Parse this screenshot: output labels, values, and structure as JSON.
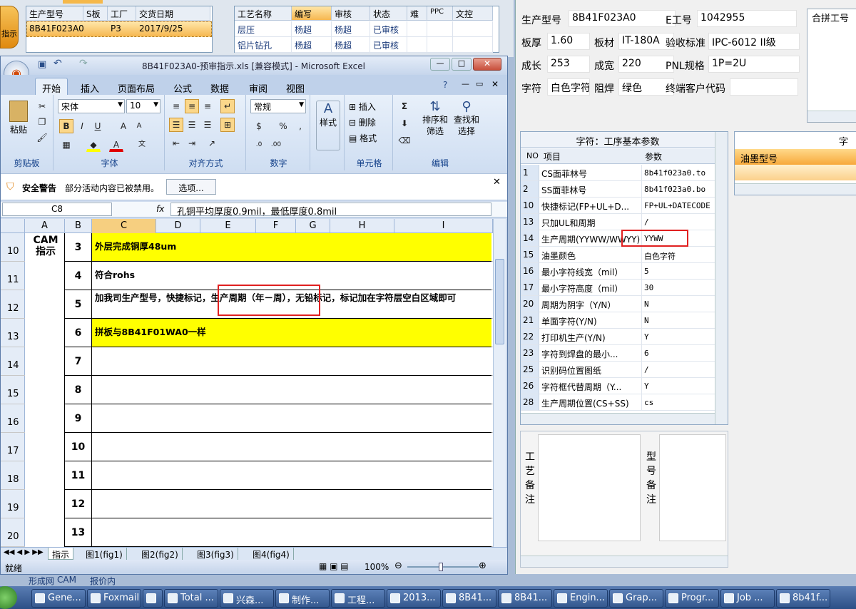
{
  "bg_app": {
    "left_btn": "指示",
    "order_table": {
      "headers": [
        "生产型号",
        "S板",
        "工厂",
        "交货日期"
      ],
      "row": [
        "8B41F023A0",
        "",
        "P3",
        "2017/9/25"
      ]
    },
    "process_table": {
      "headers": [
        "工艺名称",
        "编写",
        "审核",
        "状态",
        "难",
        "PPC",
        "文控"
      ],
      "rows": [
        [
          "层压",
          "杨超",
          "杨超",
          "已审核"
        ],
        [
          "铝片钻孔",
          "杨超",
          "杨超",
          "已审核"
        ]
      ]
    },
    "bottom_tabs": [
      "形成网",
      "CAM",
      "报价内"
    ]
  },
  "excel": {
    "title": "8B41F023A0-预审指示.xls [兼容模式] - Microsoft Excel",
    "tabs": [
      "开始",
      "插入",
      "页面布局",
      "公式",
      "数据",
      "审阅",
      "视图"
    ],
    "active_tab": "开始",
    "groups": {
      "clipboard": "剪贴板",
      "font": "字体",
      "align": "对齐方式",
      "number": "数字",
      "cells": "单元格",
      "edit": "编辑"
    },
    "paste": "粘贴",
    "font_name": "宋体",
    "font_size": "10",
    "number_fmt": "常规",
    "style": "样式",
    "insert": "插入",
    "delete": "删除",
    "format": "格式",
    "sort": "排序和筛选",
    "find": "查找和选择",
    "bold": "B",
    "italic": "I",
    "underline": "U",
    "sigma": "Σ",
    "pct": "%",
    "security_title": "安全警告",
    "security_msg": "部分活动内容已被禁用。",
    "security_btn": "选项...",
    "cell_ref": "C8",
    "fx": "fx",
    "formula": "孔铜平均厚度0.9mil，最低厚度0.8mil",
    "columns": [
      "A",
      "B",
      "C",
      "D",
      "E",
      "F",
      "G",
      "H",
      "I"
    ],
    "cam_label": "CAM\n指示",
    "rows": [
      {
        "r": "10",
        "n": "3",
        "text": "外层完成铜厚48um",
        "yellow": true
      },
      {
        "r": "11",
        "n": "4",
        "text": "符合rohs",
        "yellow": false
      },
      {
        "r": "12",
        "n": "5",
        "text": "加我司生产型号，快捷标记，生产周期（年－周），无铅标记，标记加在字符层空白区域即可",
        "yellow": false
      },
      {
        "r": "13",
        "n": "6",
        "text": "拼板与8B41F01WA0一样",
        "yellow": true
      },
      {
        "r": "14",
        "n": "7",
        "text": "",
        "yellow": false
      },
      {
        "r": "15",
        "n": "8",
        "text": "",
        "yellow": false
      },
      {
        "r": "16",
        "n": "9",
        "text": "",
        "yellow": false
      },
      {
        "r": "17",
        "n": "10",
        "text": "",
        "yellow": false
      },
      {
        "r": "18",
        "n": "11",
        "text": "",
        "yellow": false
      },
      {
        "r": "19",
        "n": "12",
        "text": "",
        "yellow": false
      },
      {
        "r": "20",
        "n": "13",
        "text": "",
        "yellow": false
      }
    ],
    "sheet_tabs": [
      "指示",
      "图1(fig1)",
      "图2(fig2)",
      "图3(fig3)",
      "图4(fig4)"
    ],
    "status": "就绪",
    "zoom": "100%"
  },
  "right": {
    "fields": [
      {
        "k": "生产型号",
        "v": "8B41F023A0"
      },
      {
        "k": "E工号",
        "v": "1042955"
      },
      {
        "k": "板厚",
        "v": "1.60"
      },
      {
        "k": "板材",
        "v": "IT-180A"
      },
      {
        "k": "验收标准",
        "v": "IPC-6012 II级"
      },
      {
        "k": "成长",
        "v": "253"
      },
      {
        "k": "成宽",
        "v": "220"
      },
      {
        "k": "PNL规格",
        "v": "1P=2U"
      },
      {
        "k": "字符",
        "v": "白色字符"
      },
      {
        "k": "阻焊",
        "v": "绿色"
      },
      {
        "k": "终端客户代码",
        "v": ""
      }
    ],
    "merge_label": "合拼工号",
    "param_title": "字符：工序基本参数",
    "param_headers": [
      "NO",
      "项目",
      "参数"
    ],
    "params": [
      [
        "1",
        "CS面菲林号",
        "8b41f023a0.to"
      ],
      [
        "2",
        "SS面菲林号",
        "8b41f023a0.bo"
      ],
      [
        "10",
        "快捷标记(FP+UL+D...",
        "FP+UL+DATECODE"
      ],
      [
        "13",
        "只加UL和周期",
        "/"
      ],
      [
        "14",
        "生产周期(YYWW/WWYY)",
        "YYWW"
      ],
      [
        "15",
        "油墨颜色",
        "白色字符"
      ],
      [
        "16",
        "最小字符线宽（mil）",
        "5"
      ],
      [
        "17",
        "最小字符高度（mil）",
        "30"
      ],
      [
        "20",
        "周期为阴字（Y/N）",
        "N"
      ],
      [
        "21",
        "单面字符(Y/N)",
        "N"
      ],
      [
        "22",
        "打印机生产(Y/N)",
        "Y"
      ],
      [
        "23",
        "字符到焊盘的最小...",
        "6"
      ],
      [
        "25",
        "识别码位置图纸",
        "/"
      ],
      [
        "26",
        "字符框代替周期（Y...",
        "Y"
      ],
      [
        "28",
        "生产周期位置(CS+SS)",
        "cs"
      ]
    ],
    "ink_panel_title": "字符",
    "ink_header": "油墨型号",
    "notes1": "工艺备注",
    "notes2": "型号备注"
  },
  "taskbar": [
    "Gene...",
    "Foxmail",
    "",
    "Total ...",
    "兴森...",
    "制作...",
    "工程...",
    "2013...",
    "8B41...",
    "8B41...",
    "Engin...",
    "Grap...",
    "Progr...",
    "Job ...",
    "8b41f..."
  ]
}
